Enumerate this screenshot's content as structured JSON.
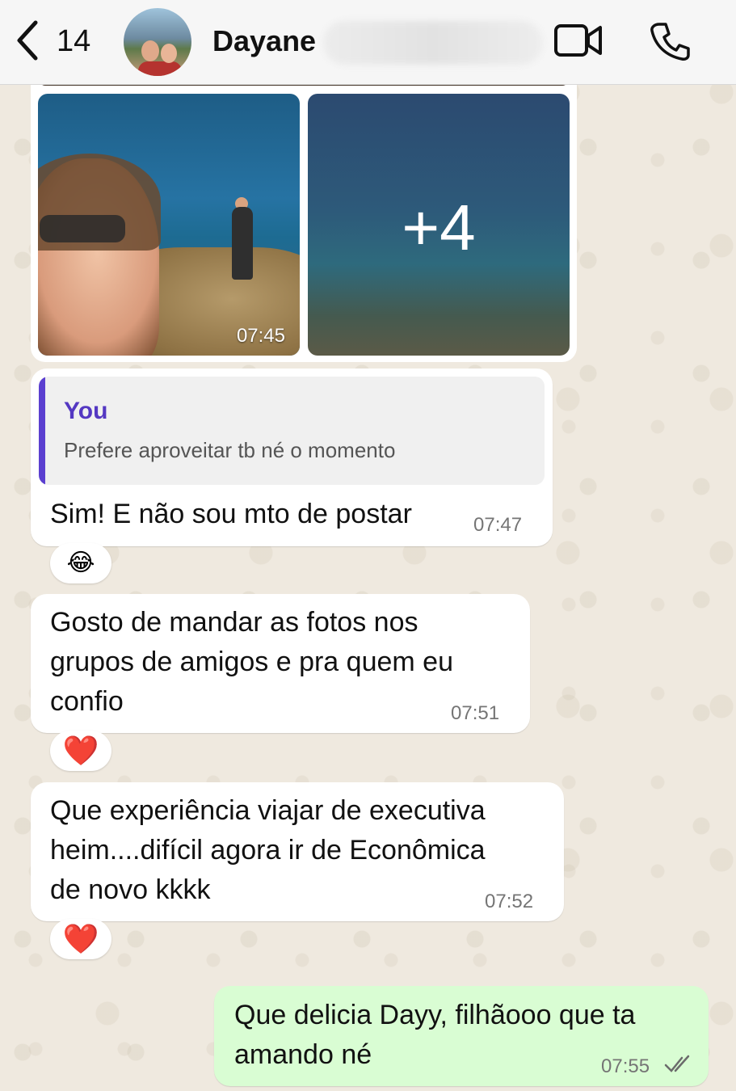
{
  "header": {
    "back_count": "14",
    "contact_name": "Dayane"
  },
  "media": {
    "photo_time": "07:45",
    "more_count": "+4"
  },
  "messages": [
    {
      "quote_author": "You",
      "quote_text": "Prefere aproveitar tb né o momento",
      "text": "Sim! E não sou mto de postar",
      "time": "07:47",
      "reaction": "😂"
    },
    {
      "lines": [
        "Gosto de mandar as fotos nos",
        "grupos de amigos e pra quem eu",
        "confio"
      ],
      "time": "07:51",
      "reaction": "❤️"
    },
    {
      "lines": [
        "Que experiência viajar de executiva",
        "heim....difícil agora ir de Econômica",
        "de novo kkkk"
      ],
      "time": "07:52",
      "reaction": "❤️"
    },
    {
      "lines": [
        "Que delicia Dayy, filhãooo que ta",
        "amando né"
      ],
      "time": "07:55",
      "outgoing": true
    }
  ],
  "colors": {
    "outgoing_bubble": "#d9fdd3",
    "incoming_bubble": "#ffffff",
    "quote_accent": "#5b3fd0",
    "background": "#efe9df"
  },
  "icons": [
    "back-chevron-icon",
    "video-call-icon",
    "phone-call-icon",
    "double-check-icon"
  ]
}
